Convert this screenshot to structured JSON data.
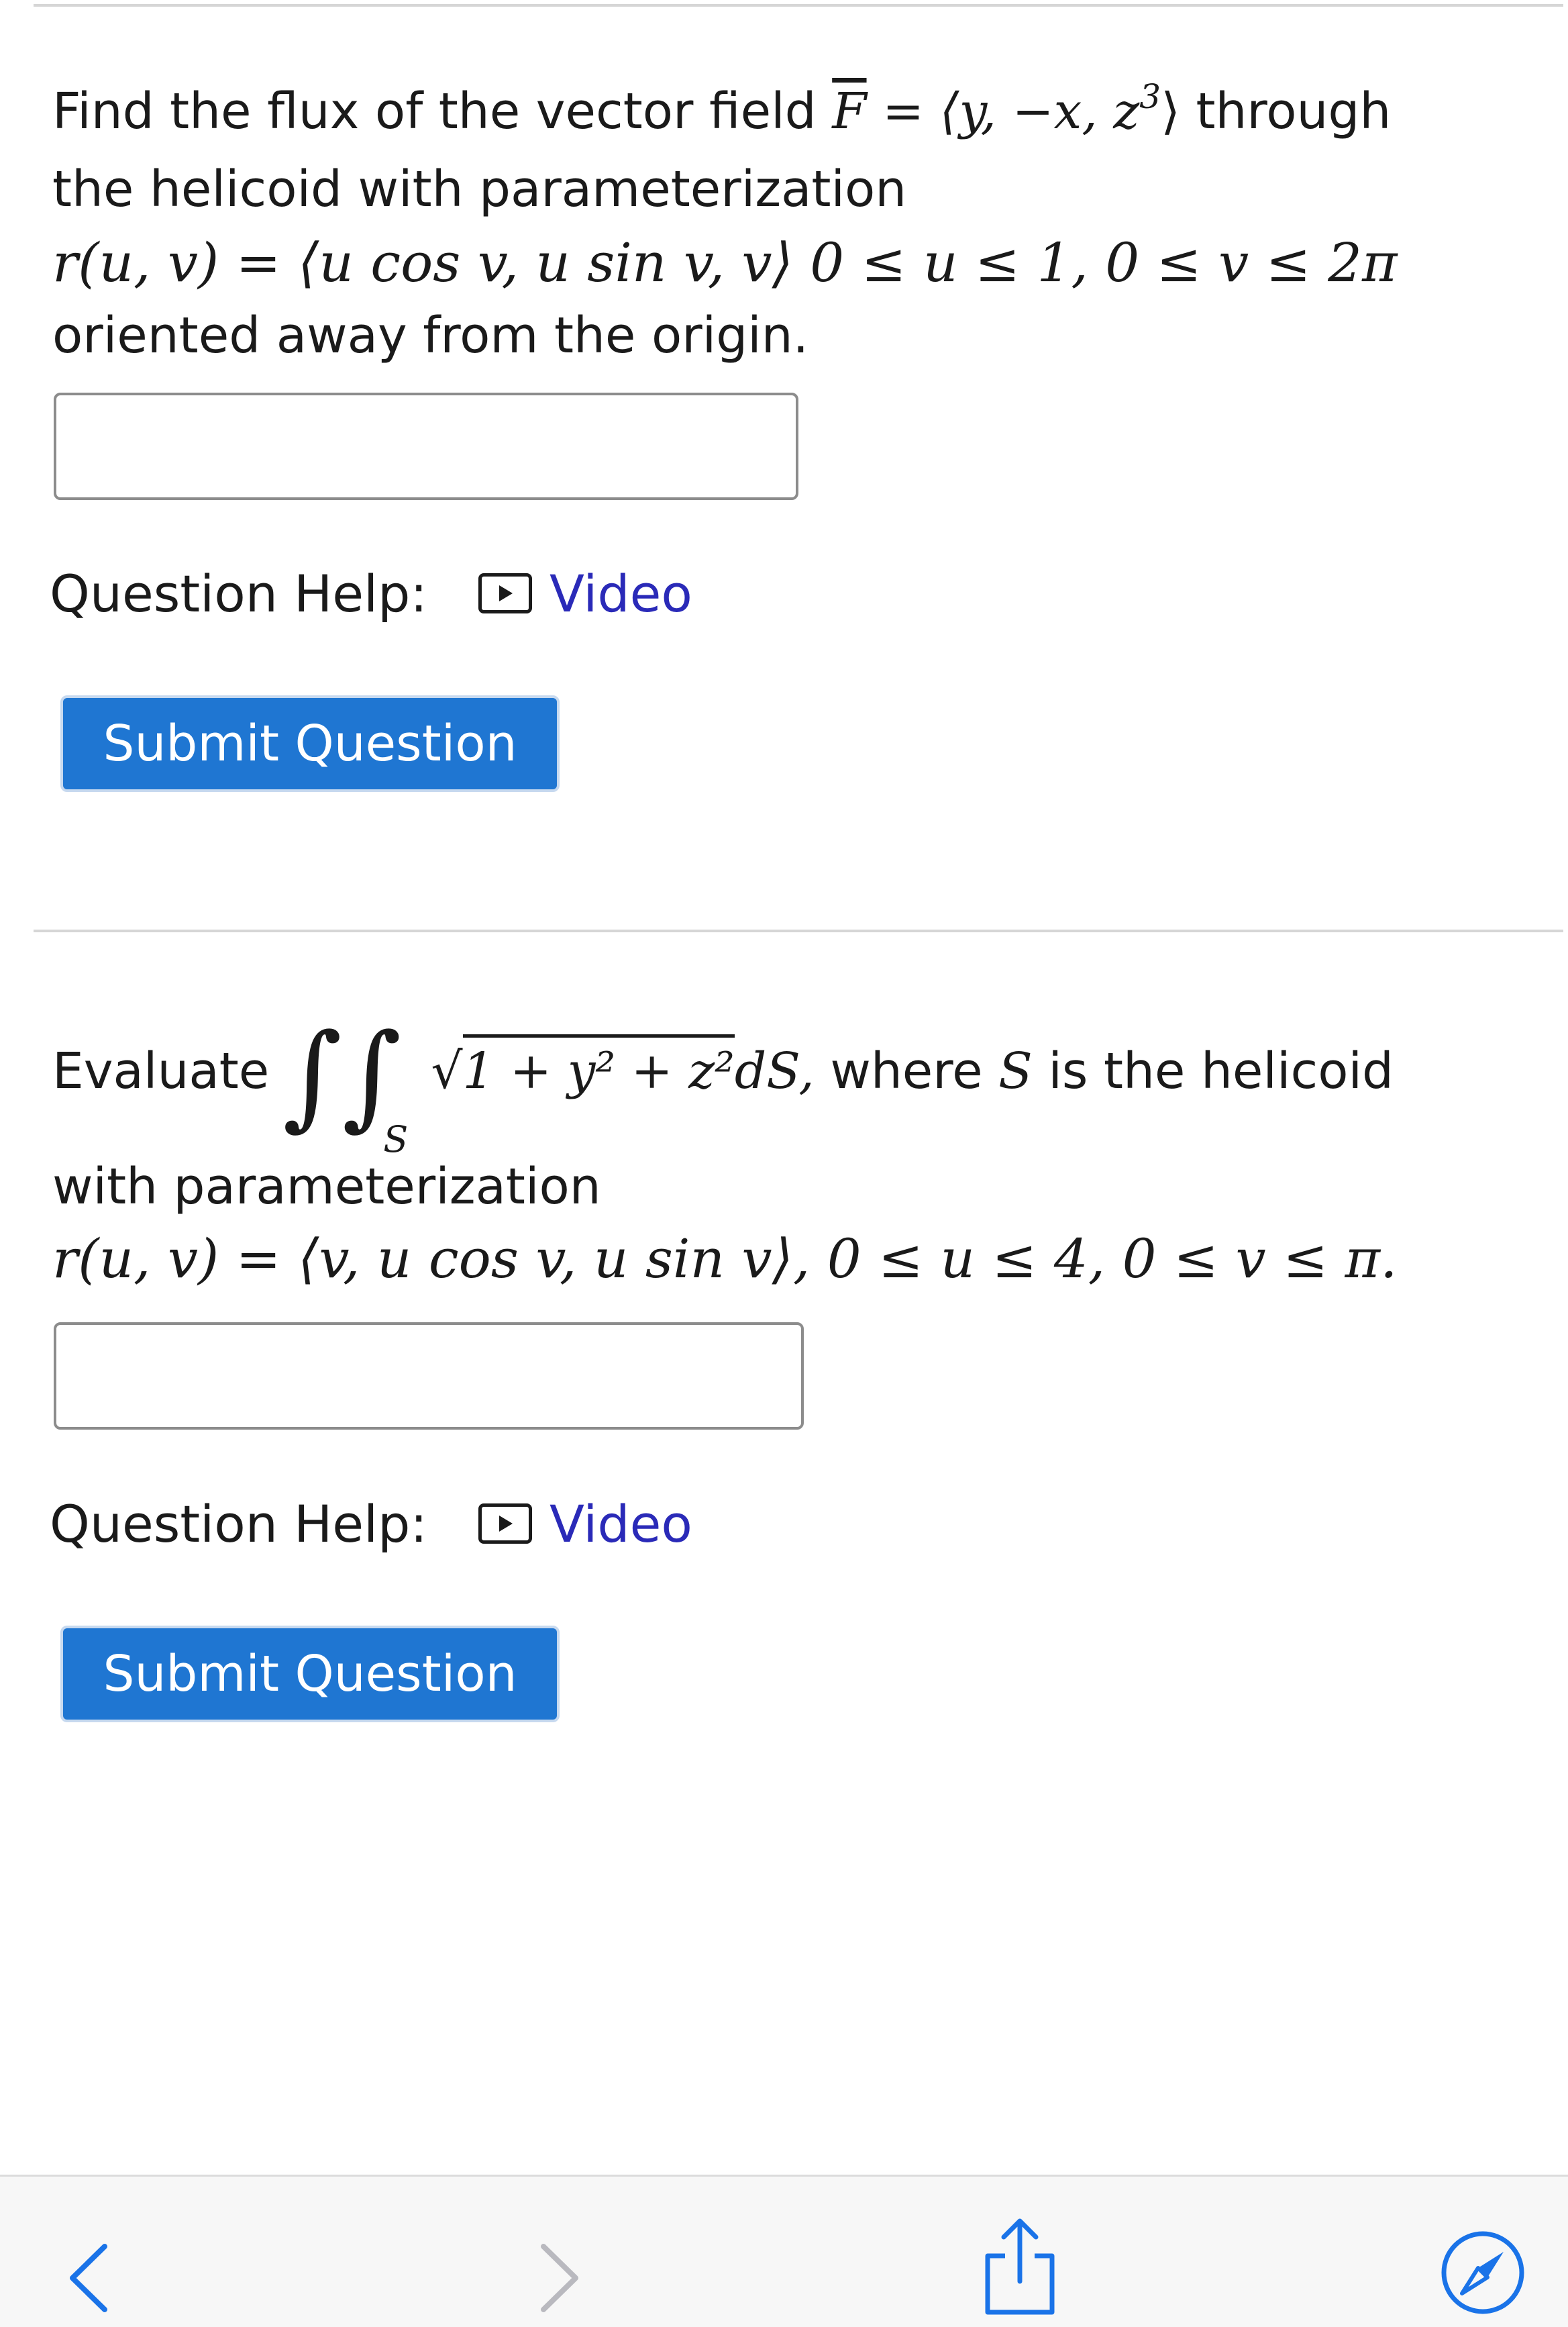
{
  "question1": {
    "text_a": "Find the flux of the vector field ",
    "math_F": "F",
    "math_eq": " = ",
    "math_field_open": "⟨y, −x, z",
    "math_field_exp": "3",
    "math_field_close": "⟩",
    "text_b": " through",
    "line2": "the helicoid with parameterization",
    "math_param": "r(u, v) = ⟨u cos v, u sin v, v⟩  0 ≤ u ≤ 1, 0 ≤ v ≤ 2π",
    "line4": "oriented away from the origin.",
    "answer_value": "",
    "help_label": "Question Help:",
    "video_label": "Video",
    "submit_label": "Submit Question"
  },
  "question2": {
    "text_a": "Evaluate",
    "integral_symbol": "∫∫",
    "integral_sub": "S",
    "radicand": "1 + y² + z²",
    "after_sqrt": "dS,",
    "text_b": " where ",
    "math_S": "S",
    "text_c": " is the helicoid",
    "line2": "with parameterization",
    "math_param": "r(u, v) = ⟨v, u cos v, u sin v⟩,  0 ≤ u ≤ 4, 0 ≤ v ≤ π.",
    "answer_value": "",
    "help_label": "Question Help:",
    "video_label": "Video",
    "submit_label": "Submit Question"
  },
  "toolbar": {
    "back_icon": "chevron-left-icon",
    "forward_icon": "chevron-right-icon",
    "share_icon": "share-icon",
    "compass_icon": "compass-icon"
  },
  "colors": {
    "accent": "#1f76d2",
    "link": "#2a2ab8",
    "ios_blue": "#1a73e8",
    "disabled": "#b9b9bf"
  }
}
